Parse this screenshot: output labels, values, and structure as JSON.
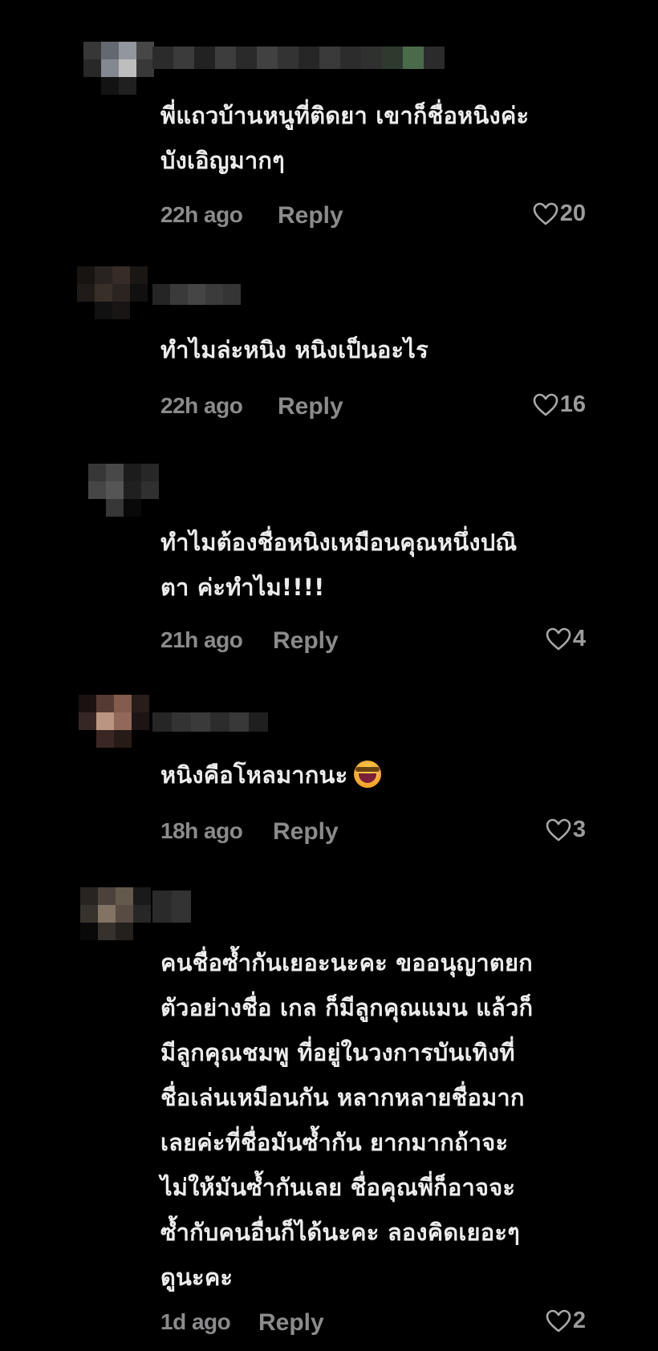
{
  "comments": [
    {
      "text": "พี่แถวบ้านหนูที่ติดยา เขาก็ชื่อหนิงค่ะ\nบังเอิญมากๆ",
      "time": "22h ago",
      "reply_label": "Reply",
      "likes": "20"
    },
    {
      "text": "ทำไมล่ะหนิง หนิงเป็นอะไร",
      "time": "22h ago",
      "reply_label": "Reply",
      "likes": "16"
    },
    {
      "text": "ทำไมต้องชื่อหนิงเหมือนคุณหนึ่งปณิ\nตา ค่ะทำไม!!!!",
      "time": "21h ago",
      "reply_label": "Reply",
      "likes": "4"
    },
    {
      "text": "หนิงคือโหลมากนะ",
      "emoji": "laughing-emoji",
      "time": "18h ago",
      "reply_label": "Reply",
      "likes": "3"
    },
    {
      "text": "คนชื่อซ้ำกันเยอะนะคะ ขออนุญาตยก\nตัวอย่างชื่อ เกล ก็มีลูกคุณแมน แล้วก็\nมีลูกคุณชมพู ที่อยู่ในวงการบันเทิงที่\nชื่อเล่นเหมือนกัน หลากหลายชื่อมาก\nเลยค่ะที่ชื่อมันซ้ำกัน ยากมากถ้าจะ\nไม่ให้มันซ้ำกันเลย ชื่อคุณพี่ก็อาจจะ\nซ้ำกับคนอื่นก็ได้นะคะ ลองคิดเยอะๆ\nดูนะคะ",
      "time": "1d ago",
      "reply_label": "Reply",
      "likes": "2"
    }
  ],
  "icons": {
    "like": "heart-outline-icon",
    "avatar": "blurred-avatar",
    "username": "blurred-username"
  },
  "colors": {
    "background": "#000000",
    "text": "#ececec",
    "meta": "#8b8b8d"
  }
}
